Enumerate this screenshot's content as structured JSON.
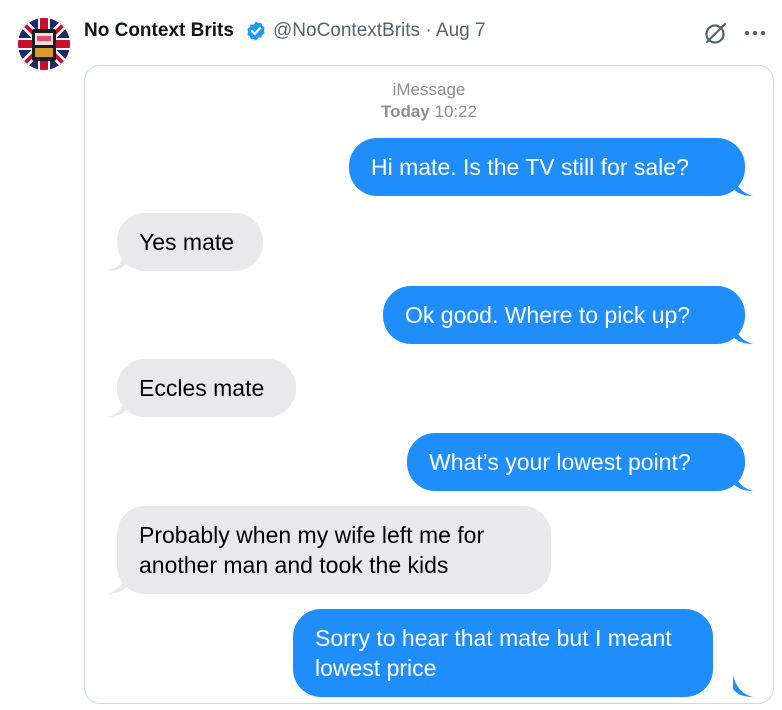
{
  "tweet": {
    "display_name": "No Context Brits",
    "handle_and_date": "@NoContextBrits · Aug 7",
    "verified_icon": "verified-badge-icon",
    "grok_icon": "grok-icon",
    "more_icon": "more-icon"
  },
  "colors": {
    "sent_bubble": "#1f8efa",
    "received_bubble": "#e9e9eb",
    "verified": "#1d9bf0",
    "secondary_text": "#536471"
  },
  "conversation": {
    "service": "iMessage",
    "day": "Today",
    "time": "10:22",
    "messages": [
      {
        "from": "me",
        "text": "Hi mate. Is the TV still for sale?"
      },
      {
        "from": "them",
        "text": "Yes mate"
      },
      {
        "from": "me",
        "text": "Ok good. Where to pick up?"
      },
      {
        "from": "them",
        "text": "Eccles mate"
      },
      {
        "from": "me",
        "text": "What’s your lowest point?"
      },
      {
        "from": "them",
        "lines": [
          "Probably when my wife left me for",
          "another man and took the kids"
        ]
      },
      {
        "from": "me",
        "lines": [
          "Sorry to hear that mate but I meant",
          "lowest price"
        ]
      }
    ]
  }
}
